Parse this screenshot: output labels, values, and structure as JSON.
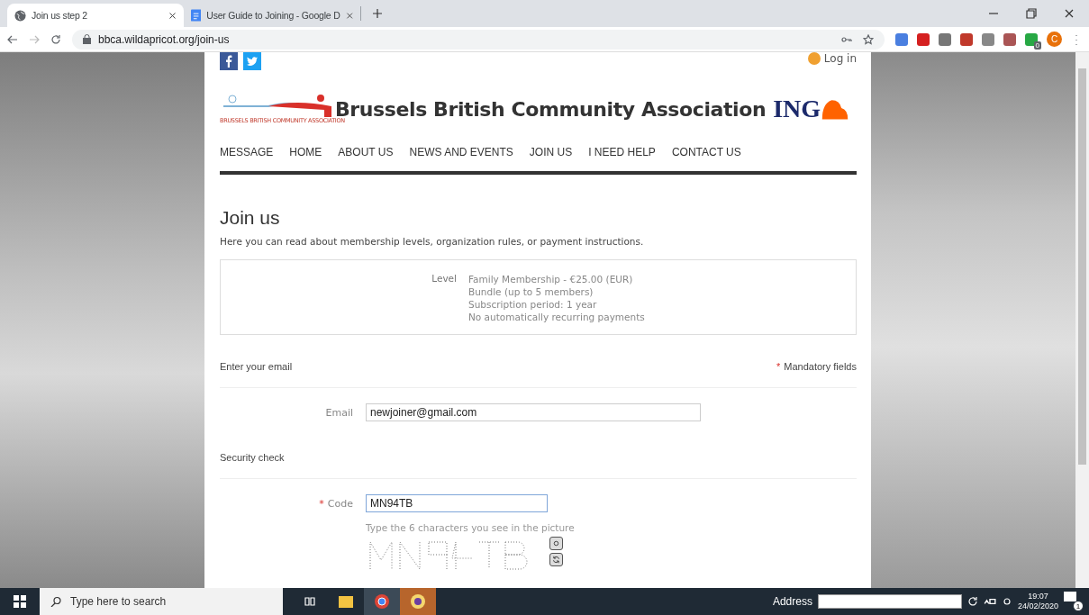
{
  "browser": {
    "tabs": [
      {
        "title": "Join us step 2",
        "kind": "globe",
        "selected": true
      },
      {
        "title": "User Guide to Joining - Google D",
        "kind": "doc",
        "selected": false
      }
    ],
    "url": "bbca.wildapricot.org/join-us",
    "profile_initial": "C",
    "extension_badge": "0"
  },
  "page": {
    "login": "Log in",
    "logo": {
      "title": "Brussels British Community Association",
      "caption": "BRUSSELS BRITISH COMMUNITY ASSOCIATION",
      "sponsor": "ING"
    },
    "nav": [
      {
        "label": "MESSAGE"
      },
      {
        "label": "HOME"
      },
      {
        "label": "ABOUT US"
      },
      {
        "label": "NEWS AND EVENTS"
      },
      {
        "label": "JOIN US"
      },
      {
        "label": "I NEED HELP"
      },
      {
        "label": "CONTACT US"
      }
    ],
    "heading": "Join us",
    "intro": "Here you can read about membership levels, organization rules, or payment instructions.",
    "level": {
      "label": "Level",
      "lines": [
        "Family Membership - €25.00 (EUR)",
        "Bundle (up to 5 members)",
        "Subscription period: 1 year",
        "No automatically recurring payments"
      ]
    },
    "sections": [
      {
        "title": "Enter your email",
        "mandatory_mark": "*",
        "mandatory_note": "Mandatory fields",
        "fields": [
          {
            "label": "Email",
            "value": "newjoiner@gmail.com",
            "focused": false
          }
        ]
      },
      {
        "title": "Security check",
        "fields": [
          {
            "label": "Code",
            "required_mark": "*",
            "value": "MN94TB",
            "focused": true
          }
        ],
        "hint": "Type the 6 characters you see in the picture"
      }
    ]
  },
  "taskbar": {
    "search_placeholder": "Type here to search",
    "address_label": "Address",
    "time": "19:07",
    "date": "24/02/2020",
    "notifications": "1"
  }
}
